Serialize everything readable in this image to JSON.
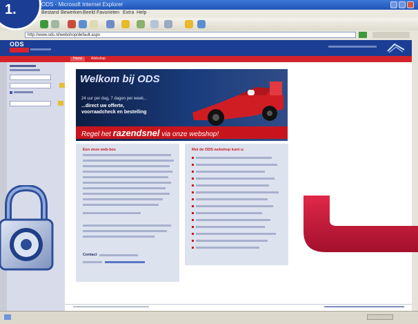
{
  "step": {
    "label": "1."
  },
  "browser": {
    "title": "ODS - Microsoft Internet Explorer",
    "menu": [
      "Bestand",
      "Bewerken",
      "Beeld",
      "Favorieten",
      "Extra",
      "Help"
    ],
    "address": "http://www.ods.nl/webshop/default.aspx"
  },
  "site": {
    "logo": "ODS",
    "tabs": [
      "Home",
      "Webshop"
    ]
  },
  "hero": {
    "title": "Welkom bij ODS",
    "line1": "24 uur per dag, 7 dagen per week...",
    "line2": "...direct uw offerte,",
    "line3": "voorraadcheck en bestelling",
    "banner_pre": "Regel het",
    "banner_big": "razendsnel",
    "banner_post": "via onze webshop!"
  },
  "columns": {
    "left_title": "Een onze web-box",
    "right_title": "Met de ODS webshop kunt u:",
    "contact_label": "Contact"
  },
  "colors": {
    "brand_blue": "#1b3d94",
    "brand_red": "#c8151d"
  }
}
